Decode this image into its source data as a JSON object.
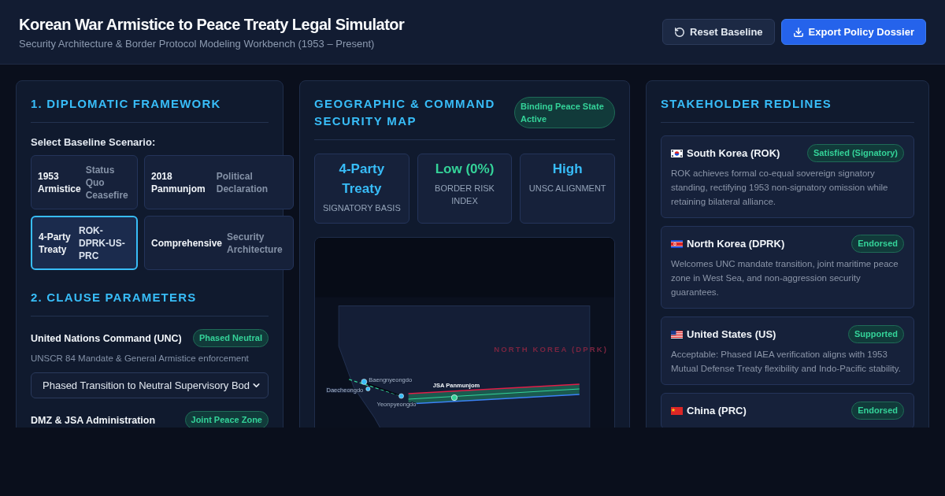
{
  "header": {
    "title": "Korean War Armistice to Peace Treaty Legal Simulator",
    "subtitle": "Security Architecture & Border Protocol Modeling Workbench (1953 – Present)",
    "buttons": [
      {
        "label": "Reset Baseline",
        "kind": "reset"
      },
      {
        "label": "Export Policy Dossier",
        "kind": "export"
      }
    ]
  },
  "framework": {
    "title": "1. DIPLOMATIC FRAMEWORK",
    "scenario_label": "Select Baseline Scenario:",
    "scenarios": [
      {
        "name": "1953 Armistice",
        "description": "Status Quo Ceasefire",
        "selected": false
      },
      {
        "name": "2018 Panmunjom",
        "description": "Political Declaration",
        "selected": false
      },
      {
        "name": "4-Party Treaty",
        "description": "ROK-DPRK-US-PRC",
        "selected": true
      },
      {
        "name": "Comprehensive",
        "description": "Security Architecture",
        "selected": false
      }
    ]
  },
  "clauses": {
    "title": "2. CLAUSE PARAMETERS",
    "items": [
      {
        "name": "United Nations Command (UNC)",
        "badge": "Phased Neutral",
        "description": "UNSCR 84 Mandate & General Armistice enforcement",
        "select": {
          "value": "Phased Transition to Neutral Supervisory Bod"
        }
      },
      {
        "name": "DMZ & JSA Administration",
        "badge": "Joint Peace Zone"
      }
    ]
  },
  "map_panel": {
    "title": "GEOGRAPHIC & COMMAND SECURITY MAP",
    "badge": "Binding Peace State Active",
    "stats": [
      {
        "value": "4-Party Treaty",
        "label": "SIGNATORY BASIS",
        "color": "#38bdf8"
      },
      {
        "value": "Low (0%)",
        "label": "BORDER RISK INDEX",
        "color": "#34d399"
      },
      {
        "value": "High",
        "label": "UNSC ALIGNMENT",
        "color": "#38bdf8"
      }
    ],
    "map": {
      "region_label": "NORTH KOREA (DPRK)",
      "jsa_label": "JSA Panmunjom",
      "islands": [
        {
          "name": "Baengnyeongdo"
        },
        {
          "name": "Daecheongdo"
        },
        {
          "name": "Yeonpyeongdo"
        }
      ]
    }
  },
  "redlines": {
    "title": "STAKEHOLDER REDLINES",
    "stakeholders": [
      {
        "kind": "rok",
        "name": "South Korea (ROK)",
        "status": "Satisfied (Signatory)",
        "description": "ROK achieves formal co-equal sovereign signatory standing, rectifying 1953 non-signatory omission while retaining bilateral alliance."
      },
      {
        "kind": "dprk",
        "name": "North Korea (DPRK)",
        "status": "Endorsed",
        "description": "Welcomes UNC mandate transition, joint maritime peace zone in West Sea, and non-aggression security guarantees."
      },
      {
        "kind": "us",
        "name": "United States (US)",
        "status": "Supported",
        "description": "Acceptable: Phased IAEA verification aligns with 1953 Mutual Defense Treaty flexibility and Indo-Pacific stability."
      },
      {
        "kind": "prc",
        "name": "China (PRC)",
        "status": "Endorsed"
      }
    ]
  }
}
